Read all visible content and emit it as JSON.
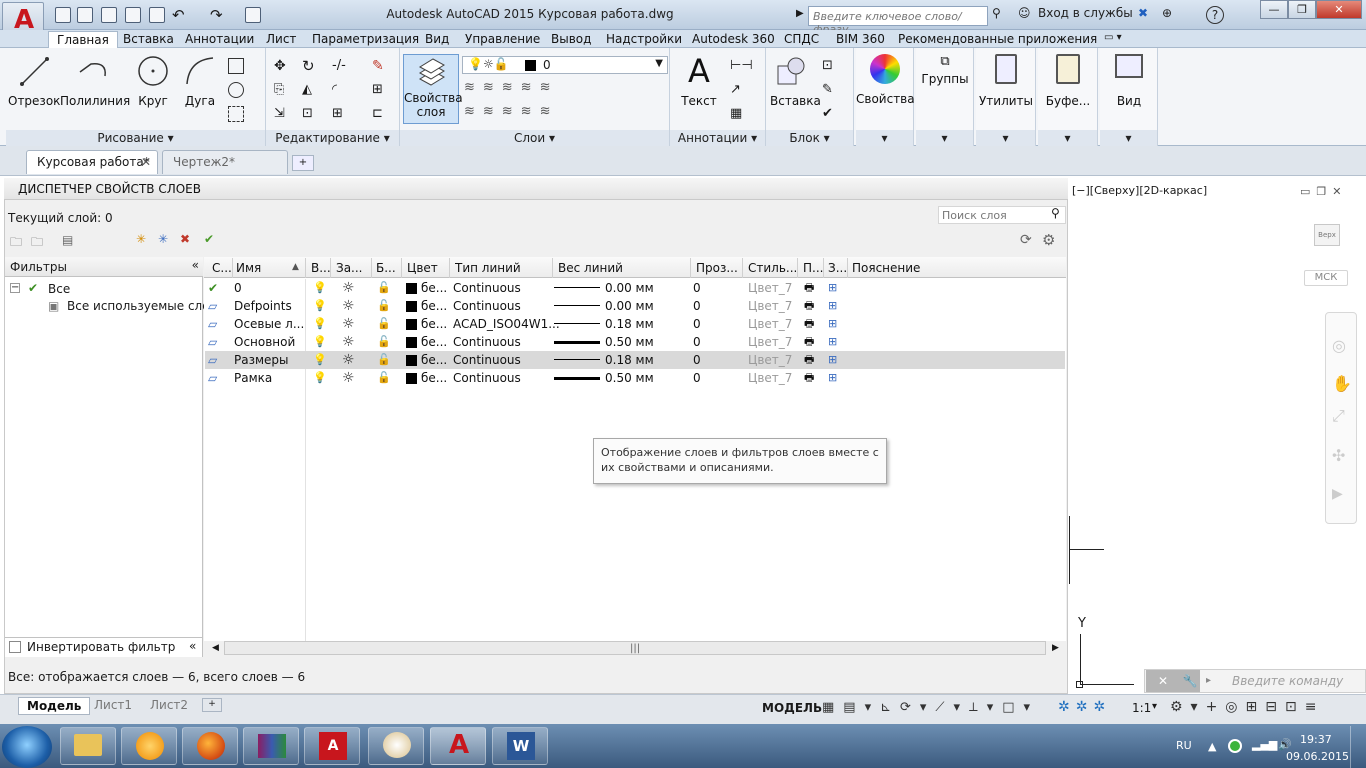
{
  "titlebar": {
    "title": "Autodesk AutoCAD 2015    Курсовая работа.dwg",
    "search_placeholder": "Введите ключевое слово/фразу",
    "signin": "Вход в службы",
    "help": "?"
  },
  "ribbon_tabs": [
    "Главная",
    "Вставка",
    "Аннотации",
    "Лист",
    "Параметризация",
    "Вид",
    "Управление",
    "Вывод",
    "Надстройки",
    "Autodesk 360",
    "СПДС",
    "BIM 360",
    "Рекомендованные приложения"
  ],
  "draw": {
    "line": "Отрезок",
    "polyline": "Полилиния",
    "circle": "Круг",
    "arc": "Дуга",
    "title": "Рисование"
  },
  "modify": {
    "title": "Редактирование"
  },
  "layers": {
    "props": "Свойства слоя",
    "current": "0",
    "title": "Слои"
  },
  "annot": {
    "text": "Текст",
    "title": "Аннотации"
  },
  "block": {
    "insert": "Вставка",
    "title": "Блок"
  },
  "others": {
    "properties": "Свойства",
    "groups": "Группы",
    "utilities": "Утилиты",
    "clipboard": "Буфе...",
    "view": "Вид"
  },
  "doc_tabs": [
    "Курсовая работа*",
    "Чертеж2*"
  ],
  "panel": {
    "title": "ДИСПЕТЧЕР СВОЙСТВ СЛОЕВ",
    "current_layer": "Текущий слой: 0",
    "search_placeholder": "Поиск слоя",
    "filters_header": "Фильтры",
    "filter_all": "Все",
    "filter_used": "Все используемые слои",
    "invert": "Инвертировать фильтр",
    "status": "Все: отображается слоев — 6, всего слоев — 6"
  },
  "columns": [
    "С...",
    "Имя",
    "В...",
    "За...",
    "Б...",
    "Цвет",
    "Тип линий",
    "Вес линий",
    "Проз...",
    "Стиль...",
    "П...",
    "З...",
    "Пояснение"
  ],
  "rows": [
    {
      "name": "0",
      "color": "бе...",
      "linetype": "Continuous",
      "lw": "0.00 мм",
      "tr": "0",
      "style": "Цвет_7",
      "current": true
    },
    {
      "name": "Defpoints",
      "color": "бе...",
      "linetype": "Continuous",
      "lw": "0.00 мм",
      "tr": "0",
      "style": "Цвет_7"
    },
    {
      "name": "Осевые л...",
      "color": "бе...",
      "linetype": "ACAD_ISO04W1...",
      "lw": "0.18 мм",
      "tr": "0",
      "style": "Цвет_7"
    },
    {
      "name": "Основной",
      "color": "бе...",
      "linetype": "Continuous",
      "lw": "0.50 мм",
      "tr": "0",
      "style": "Цвет_7"
    },
    {
      "name": "Размеры",
      "color": "бе...",
      "linetype": "Continuous",
      "lw": "0.18 мм",
      "tr": "0",
      "style": "Цвет_7",
      "selected": true
    },
    {
      "name": "Рамка",
      "color": "бе...",
      "linetype": "Continuous",
      "lw": "0.50 мм",
      "tr": "0",
      "style": "Цвет_7"
    }
  ],
  "tooltip": "Отображение слоев и фильтров слоев вместе с их свойствами и описаниями.",
  "viewport": {
    "label": "[−][Сверху][2D-каркас]",
    "ucs": "МСК",
    "cube_top": "Верх",
    "command_placeholder": "Введите команду"
  },
  "layout_tabs": [
    "Модель",
    "Лист1",
    "Лист2"
  ],
  "statusbar": {
    "model": "МОДЕЛЬ",
    "scale": "1:1"
  },
  "tray": {
    "lang": "RU",
    "time": "19:37",
    "date": "09.06.2015"
  }
}
